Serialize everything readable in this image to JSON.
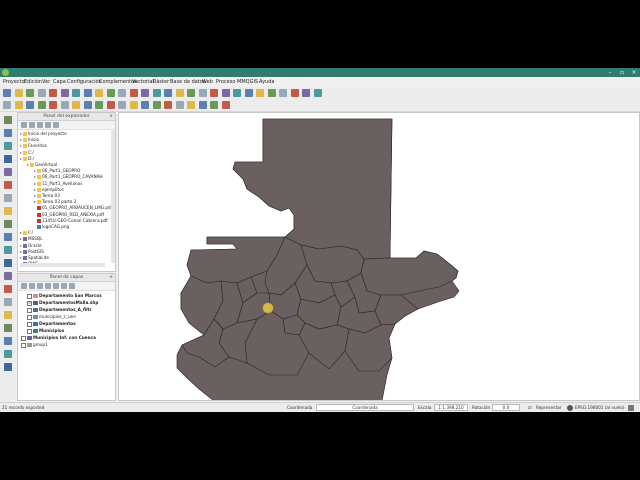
{
  "menu": [
    "Proyecto",
    "Edición",
    "Ver",
    "Capa",
    "Configuración",
    "Complementos",
    "Vectorial",
    "Ráster",
    "Base de datos",
    "Web",
    "Proceso",
    "MMQGIS",
    "Ayuda"
  ],
  "browser_panel": {
    "title": "Panel del explorador",
    "items": [
      {
        "label": "Inicio del proyecto",
        "icon": "folder",
        "indent": 0
      },
      {
        "label": "Inicio",
        "icon": "folder",
        "indent": 0
      },
      {
        "label": "Favoritos",
        "icon": "star",
        "indent": 0
      },
      {
        "label": "C:/",
        "icon": "folder",
        "indent": 0
      },
      {
        "label": "D:/",
        "icon": "folder",
        "indent": 0
      },
      {
        "label": "GeoVirtual",
        "icon": "folder",
        "indent": 1
      },
      {
        "label": "06_Part1_GEOPRO",
        "icon": "folder",
        "indent": 2
      },
      {
        "label": "06_Part1_GEOPRO_CAVANAH",
        "icon": "folder",
        "indent": 2
      },
      {
        "label": "11_Part1_Avellanos",
        "icon": "folder",
        "indent": 2
      },
      {
        "label": "ejemplitos",
        "icon": "folder",
        "indent": 2
      },
      {
        "label": "Tarea 03",
        "icon": "folder",
        "indent": 2
      },
      {
        "label": "Tarea 03 parte 2",
        "icon": "folder",
        "indent": 2
      },
      {
        "label": "01_GEOPRO_ARBAUCEN_LMG.pdf",
        "icon": "pdf",
        "indent": 2
      },
      {
        "label": "03_GEOPRO_RED_ANEXIA.pdf",
        "icon": "pdf",
        "indent": 2
      },
      {
        "label": "1345U-GEO-Conan Cabrera.pdf",
        "icon": "pdf",
        "indent": 2
      },
      {
        "label": "logoCAG.png",
        "icon": "img",
        "indent": 2
      },
      {
        "label": "F:/",
        "icon": "folder",
        "indent": 0
      },
      {
        "label": "MSSQL",
        "icon": "db",
        "indent": 0
      },
      {
        "label": "Oracle",
        "icon": "db",
        "indent": 0
      },
      {
        "label": "PostGIS",
        "icon": "db",
        "indent": 0
      },
      {
        "label": "SpatiaLite",
        "icon": "db",
        "indent": 0
      },
      {
        "label": "OWS",
        "icon": "db",
        "indent": 0
      }
    ]
  },
  "layers_panel": {
    "title": "Panel de capas",
    "layers": [
      {
        "label": "Departamento San Marcos",
        "checked": false,
        "color": "#d98c8c",
        "bold": true,
        "indent": 1
      },
      {
        "label": "DepartamentosMalla.shp",
        "checked": true,
        "color": "#6b5a5a",
        "bold": true,
        "indent": 1
      },
      {
        "label": "Departamentos_A_filtr",
        "checked": false,
        "color": "#4a6fa5",
        "bold": true,
        "indent": 1
      },
      {
        "label": "municipios_c_unir",
        "checked": false,
        "color": "#7a8a9a",
        "bold": false,
        "indent": 1
      },
      {
        "label": "Departamentos",
        "checked": false,
        "color": "#3c6e9e",
        "bold": true,
        "indent": 1
      },
      {
        "label": "Municipios",
        "checked": false,
        "color": "#2a8a7a",
        "bold": true,
        "indent": 1
      },
      {
        "label": "Municipios Inf. con Cuenca",
        "checked": false,
        "color": "#7b5ea0",
        "bold": true,
        "indent": 0
      },
      {
        "label": "group1",
        "checked": false,
        "color": "#999999",
        "bold": false,
        "indent": 0
      }
    ]
  },
  "status": {
    "message": "21 records exported",
    "coord_label": "Coordenada",
    "coord_value": "Coordenada",
    "scale_label": "Escala",
    "scale_value": "1:1.398.210",
    "rotation_label": "Rotación",
    "rotation_value": "0.0",
    "render_label": "Representar",
    "crs": "EPSG:198001 (al vuelo)"
  },
  "colors": {
    "map_fill": "#6b6060",
    "map_stroke": "#2a2424",
    "titlebar": "#2e7d6e"
  }
}
